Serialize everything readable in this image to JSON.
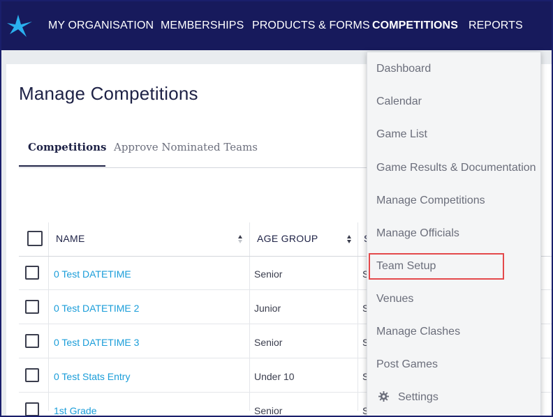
{
  "topnav": {
    "items": [
      {
        "label": "MY ORGANISATION"
      },
      {
        "label": "MEMBERSHIPS"
      },
      {
        "label": "PRODUCTS & FORMS"
      },
      {
        "label": "COMPETITIONS"
      },
      {
        "label": "REPORTS"
      }
    ],
    "active": "COMPETITIONS"
  },
  "page": {
    "title": "Manage Competitions",
    "tabs": [
      {
        "label": "Competitions"
      },
      {
        "label": "Approve Nominated Teams"
      }
    ]
  },
  "table": {
    "headers": {
      "name": "NAME",
      "age_group": "AGE GROUP"
    },
    "rows": [
      {
        "name": "0 Test DATETIME",
        "age_group": "Senior",
        "next": "S"
      },
      {
        "name": "0 Test DATETIME 2",
        "age_group": "Junior",
        "next": "S"
      },
      {
        "name": "0 Test DATETIME 3",
        "age_group": "Senior",
        "next": "S"
      },
      {
        "name": "0 Test Stats Entry",
        "age_group": "Under 10",
        "next": "S"
      },
      {
        "name": "1st Grade",
        "age_group": "Senior",
        "next": "S"
      }
    ]
  },
  "dropdown": {
    "items": [
      {
        "label": "Dashboard"
      },
      {
        "label": "Calendar"
      },
      {
        "label": "Game List"
      },
      {
        "label": "Game Results & Documentation"
      },
      {
        "label": "Manage Competitions"
      },
      {
        "label": "Manage Officials"
      },
      {
        "label": "Team Setup"
      },
      {
        "label": "Venues"
      },
      {
        "label": "Manage Clashes"
      },
      {
        "label": "Post Games"
      },
      {
        "label": "Settings"
      }
    ],
    "highlighted": "Team Setup"
  },
  "colors": {
    "nav_bg": "#171a5c",
    "link": "#1a9dd9",
    "highlight": "#e4494b"
  }
}
